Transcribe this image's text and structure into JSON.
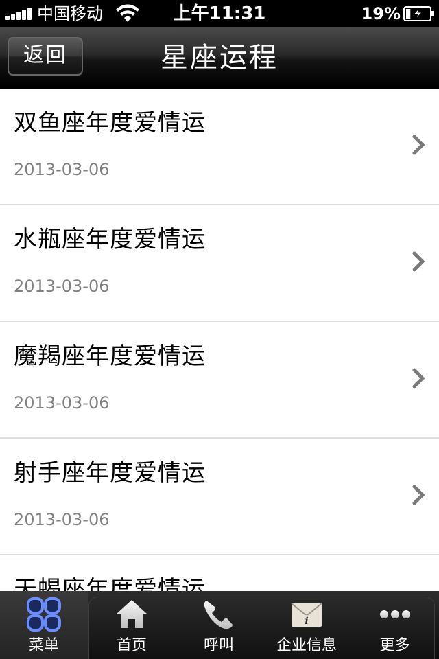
{
  "status_bar": {
    "carrier": "中国移动",
    "time": "上午11:31",
    "battery_percent": "19%",
    "battery_level": 0.19
  },
  "navbar": {
    "back_label": "返回",
    "title": "星座运程"
  },
  "list": {
    "items": [
      {
        "title": "双鱼座年度爱情运",
        "date": "2013-03-06"
      },
      {
        "title": "水瓶座年度爱情运",
        "date": "2013-03-06"
      },
      {
        "title": "魔羯座年度爱情运",
        "date": "2013-03-06"
      },
      {
        "title": "射手座年度爱情运",
        "date": "2013-03-06"
      },
      {
        "title": "天蝎座年度爱情运",
        "date": ""
      }
    ]
  },
  "tabbar": {
    "tabs": [
      {
        "label": "菜单",
        "icon": "menu-grid-icon"
      },
      {
        "label": "首页",
        "icon": "home-icon"
      },
      {
        "label": "呼叫",
        "icon": "phone-icon"
      },
      {
        "label": "企业信息",
        "icon": "info-envelope-icon"
      },
      {
        "label": "更多",
        "icon": "more-dots-icon"
      }
    ]
  }
}
